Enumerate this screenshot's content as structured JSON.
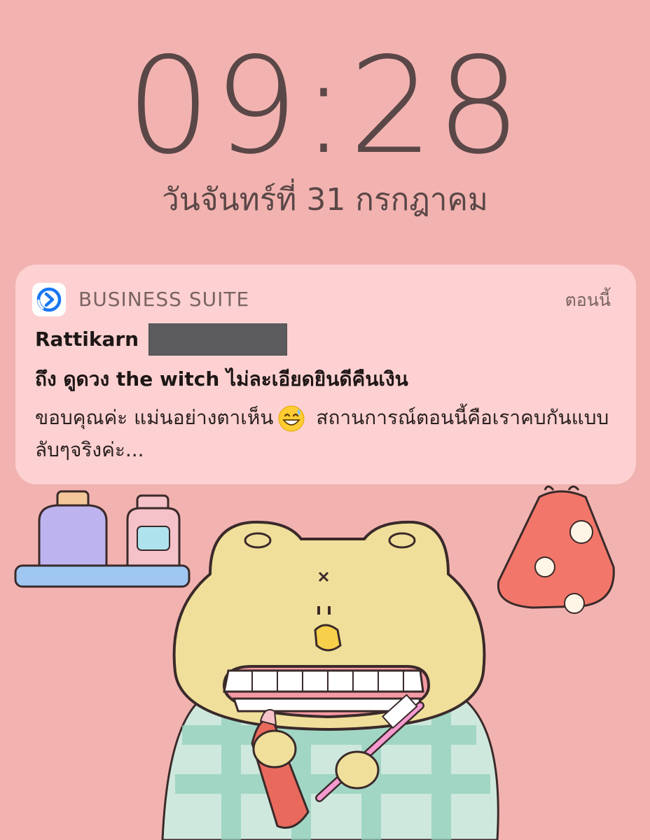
{
  "lockscreen": {
    "time": "09:28",
    "date": "วันจันทร์ที่ 31 กรกฎาคม"
  },
  "notification": {
    "app_name": "BUSINESS SUITE",
    "app_icon": "business-suite-icon",
    "timestamp": "ตอนนี้",
    "sender": "Rattikarn",
    "subject": "ถึง ดูดวง the witch ไม่ละเอียดยินดีคืนเงิน",
    "body_part1": "ขอบคุณค่ะ แม่นอย่างตาเห็น",
    "body_emoji": "grinning-sweat-emoji",
    "body_part2": "สถานการณ์ตอนนี้คือเราคบกันแบบลับๆจริงค่ะ..."
  },
  "colors": {
    "background": "#f2b3b0",
    "clock_text": "#5a4747",
    "notification_bg": "#ffd8d8",
    "app_accent": "#1877f2"
  }
}
